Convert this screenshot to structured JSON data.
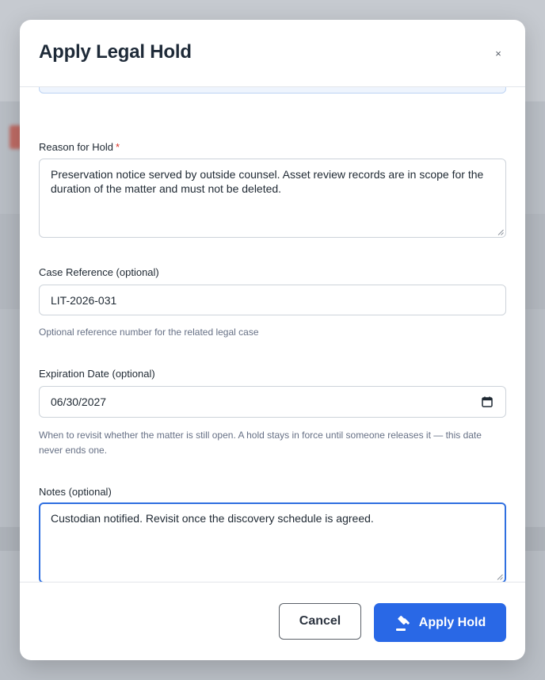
{
  "modal": {
    "title": "Apply Legal Hold",
    "close_glyph": "×"
  },
  "form": {
    "reason": {
      "label": "Reason for Hold",
      "required_mark": "*",
      "value": "Preservation notice served by outside counsel. Asset review records are in scope for the duration of the matter and must not be deleted."
    },
    "case_reference": {
      "label": "Case Reference (optional)",
      "value": "LIT-2026-031",
      "hint": "Optional reference number for the related legal case"
    },
    "expiration_date": {
      "label": "Expiration Date (optional)",
      "value": "06/30/2027",
      "hint": "When to revisit whether the matter is still open. A hold stays in force until someone releases it — this date never ends one."
    },
    "notes": {
      "label": "Notes (optional)",
      "value": "Custodian notified. Revisit once the discovery schedule is agreed."
    }
  },
  "footer": {
    "cancel_label": "Cancel",
    "apply_label": "Apply Hold"
  },
  "icons": {
    "close": "close-icon",
    "calendar": "calendar-icon",
    "apply": "gavel-icon",
    "resize": "resize-handle-icon"
  },
  "colors": {
    "primary": "#2968e6",
    "focus_border": "#2f6fe0",
    "required": "#d93025",
    "title_text": "#1e2a38"
  }
}
